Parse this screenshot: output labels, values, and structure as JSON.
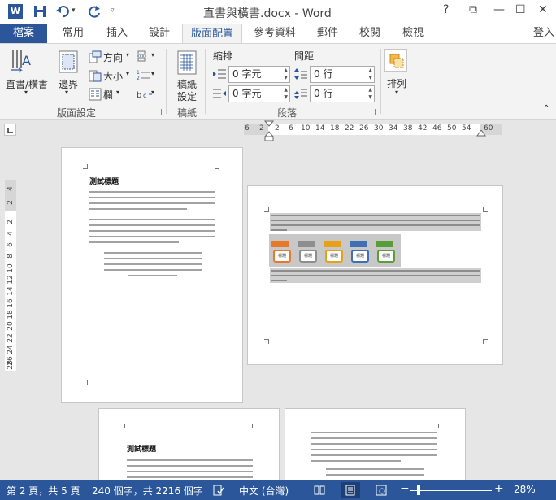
{
  "titlebar": {
    "logo": "W",
    "title": "直書與橫書.docx - Word",
    "help": "?",
    "restore": "⧉",
    "minimize": "—",
    "maximize": "☐",
    "close": "✕"
  },
  "tabs": {
    "file": "檔案",
    "items": [
      "常用",
      "插入",
      "設計",
      "版面配置",
      "參考資料",
      "郵件",
      "校閱",
      "檢視"
    ],
    "login": "登入"
  },
  "ribbon": {
    "text_direction": "直書/橫書",
    "margins": "邊界",
    "orientation": "方向",
    "size": "大小",
    "columns": "欄",
    "breaks_icon": "hyphenation-icon",
    "manuscript_line1": "稿紙",
    "manuscript_line2": "設定",
    "indent_label": "縮排",
    "spacing_label": "間距",
    "indent_left": "0 字元",
    "indent_right": "0 字元",
    "spacing_before": "0 行",
    "spacing_after": "0 行",
    "arrange": "排列",
    "group_page_setup": "版面設定",
    "group_manuscript": "稿紙",
    "group_paragraph": "段落"
  },
  "ruler": {
    "h_ticks": [
      "6",
      "2",
      "2",
      "6",
      "10",
      "14",
      "18",
      "22",
      "26",
      "30",
      "34",
      "38",
      "42",
      "46",
      "50",
      "54",
      "60"
    ],
    "v_ticks": [
      "4",
      "2",
      "2",
      "4",
      "6",
      "8",
      "10",
      "12",
      "14",
      "16",
      "18",
      "20",
      "22",
      "24",
      "26",
      "28"
    ]
  },
  "pages": {
    "title_text": "測試標題",
    "diagram_labels": [
      "標題",
      "標題",
      "標題",
      "標題",
      "標題"
    ]
  },
  "status": {
    "page": "第 2 頁，共 5 頁",
    "words": "240 個字，共 2216 個字",
    "language": "中文 (台灣)",
    "zoom_minus": "−",
    "zoom_plus": "+",
    "zoom": "28%"
  },
  "colors": {
    "brand": "#2b579a",
    "box_colors": [
      "#e8792b",
      "#8e8e8e",
      "#e8a019",
      "#3f6fb5",
      "#5a9e3a"
    ]
  }
}
